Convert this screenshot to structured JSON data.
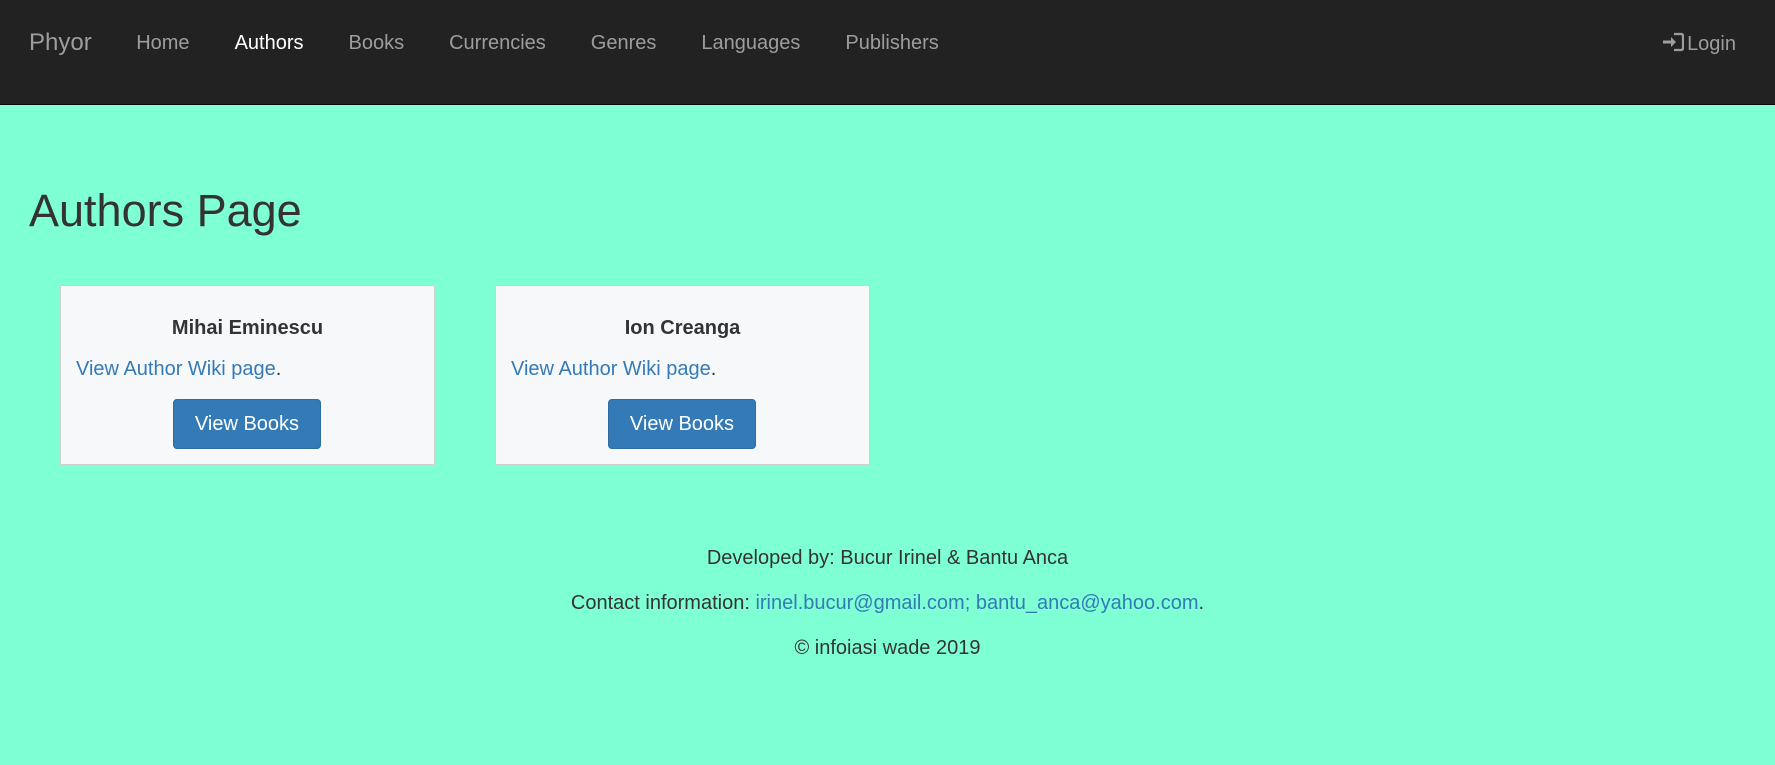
{
  "navbar": {
    "brand": "Phyor",
    "items": [
      {
        "label": "Home"
      },
      {
        "label": "Authors"
      },
      {
        "label": "Books"
      },
      {
        "label": "Currencies"
      },
      {
        "label": "Genres"
      },
      {
        "label": "Languages"
      },
      {
        "label": "Publishers"
      }
    ],
    "active": "Authors",
    "login_label": "Login",
    "login_icon": "sign-in-icon"
  },
  "page": {
    "title": "Authors Page"
  },
  "authors": [
    {
      "name": "Mihai Eminescu",
      "wiki_link": "View Author Wiki page",
      "wiki_suffix": ".",
      "button": "View Books"
    },
    {
      "name": "Ion Creanga",
      "wiki_link": "View Author Wiki page",
      "wiki_suffix": ".",
      "button": "View Books"
    }
  ],
  "footer": {
    "developed_by": "Developed by: Bucur Irinel & Bantu Anca",
    "contact_label": "Contact information: ",
    "contact_emails": "irinel.bucur@gmail.com; bantu_anca@yahoo.com",
    "contact_suffix": ".",
    "copyright": "© infoiasi wade 2019"
  },
  "colors": {
    "background": "#7fffd4",
    "navbar": "#222222",
    "link": "#337ab7",
    "button": "#337ab7",
    "card": "#f6f8fa"
  }
}
